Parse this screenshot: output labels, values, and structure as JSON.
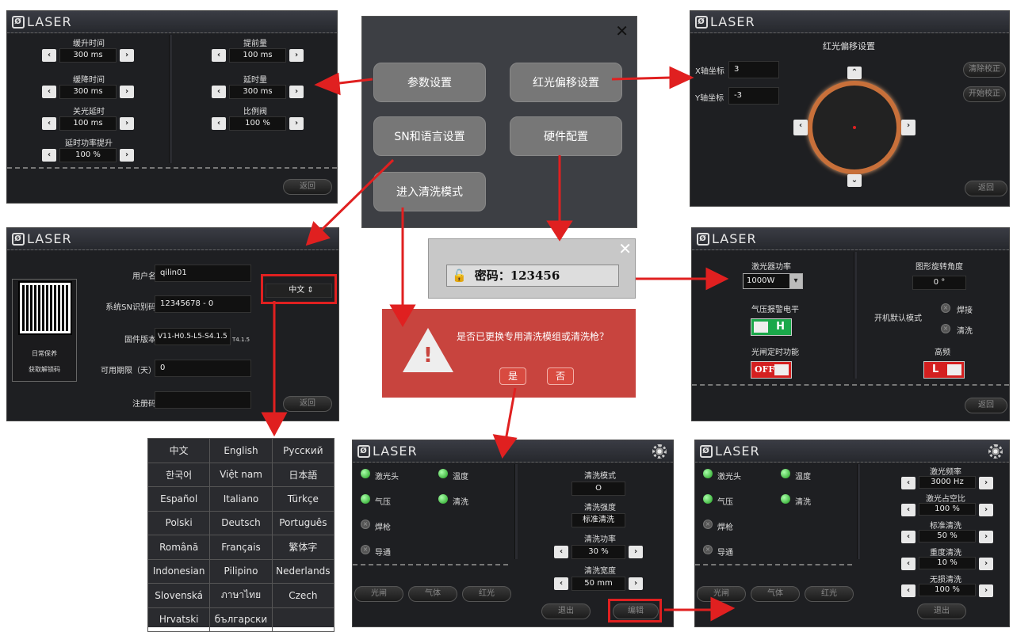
{
  "logo": "LASER",
  "p1": {
    "items": [
      {
        "label": "缓升时间",
        "value": "300 ms"
      },
      {
        "label": "提前量",
        "value": "100 ms"
      },
      {
        "label": "缓降时间",
        "value": "300 ms"
      },
      {
        "label": "延时量",
        "value": "300 ms"
      },
      {
        "label": "关光延时",
        "value": "100 ms"
      },
      {
        "label": "比例阀",
        "value": "100 %"
      },
      {
        "label": "延时功率提升",
        "value": "100 %"
      }
    ],
    "back": "返回"
  },
  "menu": {
    "close": "✕",
    "b1": "参数设置",
    "b2": "红光偏移设置",
    "b3": "SN和语言设置",
    "b4": "硬件配置",
    "b5": "进入清洗模式"
  },
  "p2": {
    "title": "红光偏移设置",
    "xlabel": "X轴坐标",
    "xval": "3",
    "ylabel": "Y轴坐标",
    "yval": "-3",
    "clear": "清除校正",
    "start": "开始校正",
    "back": "返回"
  },
  "p3": {
    "user_label": "用户名",
    "user": "qilin01",
    "sn_label": "系统SN识别码",
    "sn": "12345678 - 0",
    "fw_label": "固件版本",
    "fw": "V11-H0.5-L5-S4.1.5",
    "fw_sub": "T4.1.5",
    "period_label": "可用期限（天）",
    "period": "0",
    "reg_label": "注册码",
    "lang": "中文",
    "qr1": "日常保养",
    "qr2": "获取解锁码",
    "back": "返回"
  },
  "pwd": {
    "label": "密码：123456",
    "close": "✕"
  },
  "p4": {
    "power_label": "激光器功率",
    "power": "1000W",
    "rot_label": "图形旋转角度",
    "rot": "0 °",
    "alarm_label": "气压报警电平",
    "alarm": "H",
    "boot_label": "开机默认模式",
    "opt1": "焊接",
    "opt2": "清洗",
    "shutter_label": "光闸定时功能",
    "shutter": "OFF",
    "hf_label": "高频",
    "hf": "L",
    "back": "返回"
  },
  "alert": {
    "text": "是否已更换专用清洗模组或清洗枪？",
    "yes": "是",
    "no": "否"
  },
  "langs": [
    [
      "中文",
      "English",
      "Русский"
    ],
    [
      "한국어",
      "Việt nam",
      "日本語"
    ],
    [
      "Español",
      "Italiano",
      "Türkçe"
    ],
    [
      "Polski",
      "Deutsch",
      "Português"
    ],
    [
      "Română",
      "Français",
      "繁体字"
    ],
    [
      "Indonesian",
      "Pilipino",
      "Nederlands"
    ],
    [
      "Slovenská",
      "ภาษาไทย",
      "Czech"
    ],
    [
      "Hrvatski",
      "български",
      ""
    ]
  ],
  "p5": {
    "s1": "激光头",
    "s2": "温度",
    "s3": "气压",
    "s4": "清洗",
    "s5": "焊枪",
    "s6": "导通",
    "mode_label": "清洗模式",
    "mode": "O",
    "strength_label": "清洗强度",
    "strength": "标准清洗",
    "power_label": "清洗功率",
    "power": "30 %",
    "width_label": "清洗宽度",
    "width": "50 mm",
    "b1": "光闸",
    "b2": "气体",
    "b3": "红光",
    "exit": "退出",
    "edit": "编辑"
  },
  "p6": {
    "s1": "激光头",
    "s2": "温度",
    "s3": "气压",
    "s4": "清洗",
    "s5": "焊枪",
    "s6": "导通",
    "freq_label": "激光频率",
    "freq": "3000 Hz",
    "duty_label": "激光占空比",
    "duty": "100 %",
    "std_label": "标准清洗",
    "std": "50 %",
    "heavy_label": "重度清洗",
    "heavy": "10 %",
    "nodmg_label": "无损清洗",
    "nodmg": "100 %",
    "b1": "光闸",
    "b2": "气体",
    "b3": "红光",
    "exit": "退出"
  }
}
